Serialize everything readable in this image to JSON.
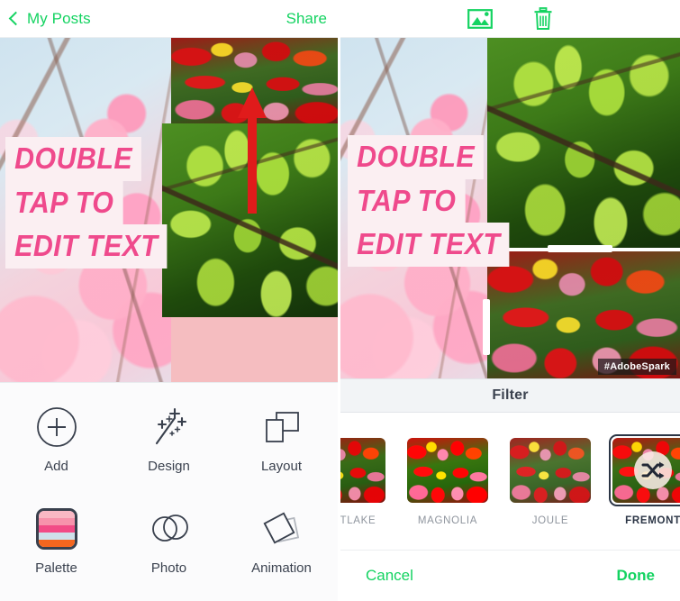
{
  "left_screen": {
    "nav": {
      "back_label": "My Posts",
      "back_icon": "chevron-left-icon",
      "share_label": "Share"
    },
    "canvas": {
      "headline_lines": [
        "DOUBLE",
        "TAP TO",
        "EDIT TEXT"
      ],
      "headline_text_color": "#ef4a8c",
      "headline_bg_color": "#fbeff2",
      "cells": [
        {
          "name": "cherry-blossom-photo",
          "kind": "photo"
        },
        {
          "name": "tulips-photo",
          "kind": "photo"
        },
        {
          "name": "green-leaves-photo",
          "kind": "photo"
        },
        {
          "name": "pink-color-block",
          "kind": "color",
          "color": "#f5bdc0"
        }
      ],
      "annotation": {
        "name": "red-up-arrow",
        "color": "#e01b1b"
      }
    },
    "toolbar": {
      "items": [
        {
          "label": "Add",
          "icon": "plus-circle-icon"
        },
        {
          "label": "Design",
          "icon": "magic-wand-icon"
        },
        {
          "label": "Layout",
          "icon": "overlapping-rectangles-icon"
        },
        {
          "label": "Palette",
          "icon": "color-palette-icon"
        },
        {
          "label": "Photo",
          "icon": "overlapping-circles-icon"
        },
        {
          "label": "Animation",
          "icon": "tilted-squares-icon"
        }
      ],
      "palette_colors": [
        "#f9b8c4",
        "#f792ab",
        "#f24b86",
        "#cfe0ea",
        "#f4661f"
      ]
    }
  },
  "right_screen": {
    "nav": {
      "image_icon": "image-picture-icon",
      "delete_icon": "trash-can-icon"
    },
    "canvas": {
      "headline_lines": [
        "DOUBLE",
        "TAP TO",
        "EDIT TEXT"
      ],
      "watermark": "#AdobeSpark",
      "cells": [
        {
          "name": "cherry-blossom-photo",
          "kind": "photo"
        },
        {
          "name": "green-leaves-photo",
          "kind": "photo"
        },
        {
          "name": "tulips-photo-selected",
          "kind": "photo",
          "selected": true
        }
      ]
    },
    "filter_panel": {
      "title": "Filter",
      "filters": [
        {
          "name": "MONTLAKE",
          "selected": false,
          "style": "f-montlake"
        },
        {
          "name": "MAGNOLIA",
          "selected": false,
          "style": "f-magnolia"
        },
        {
          "name": "JOULE",
          "selected": false,
          "style": "f-joule"
        },
        {
          "name": "FREMONT",
          "selected": true,
          "style": "f-fremont",
          "badge_icon": "shuffle-icon"
        },
        {
          "name": "",
          "selected": false,
          "style": "f-sepia"
        }
      ]
    },
    "actions": {
      "cancel_label": "Cancel",
      "done_label": "Done"
    }
  },
  "theme": {
    "accent_green": "#14d361",
    "dark_text": "#3b424f",
    "muted_text": "#8e949d"
  }
}
